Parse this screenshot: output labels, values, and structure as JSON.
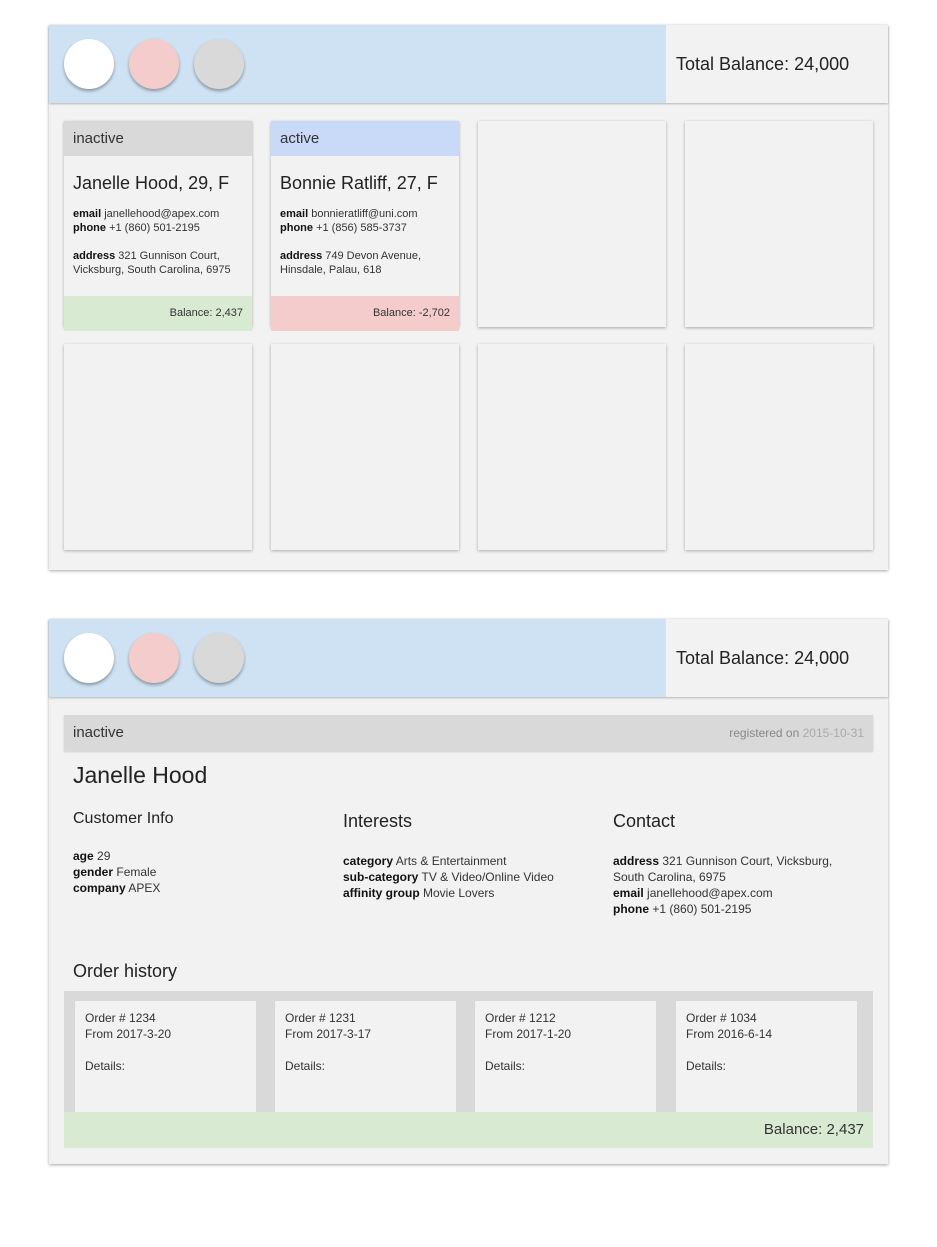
{
  "colors": {
    "header_accent": "#cfe2f3",
    "inactive": "#d9d9d9",
    "active": "#c9daf8",
    "positive": "#d9ead3",
    "negative": "#f4cccc",
    "circle_white": "#ffffff",
    "circle_pink": "#f4cccc",
    "circle_grey": "#d9d9d9"
  },
  "grid_view": {
    "total_balance": "Total Balance: 24,000",
    "cards": [
      {
        "status": "inactive",
        "name": "Janelle Hood, 29, F",
        "email_label": "email",
        "email": "janellehood@apex.com",
        "phone_label": "phone",
        "phone": "+1 (860) 501-2195",
        "address_label": "address",
        "address": "321 Gunnison Court, Vicksburg, South Carolina, 6975",
        "balance": "Balance: 2,437"
      },
      {
        "status": "active",
        "name": "Bonnie Ratliff, 27, F",
        "email_label": "email",
        "email": "bonnieratliff@uni.com",
        "phone_label": "phone",
        "phone": "+1 (856) 585-3737",
        "address_label": "address",
        "address": "749 Devon Avenue, Hinsdale, Palau, 618",
        "balance": "Balance: -2,702"
      }
    ]
  },
  "detail_view": {
    "total_balance": "Total Balance: 24,000",
    "status": "inactive",
    "registered_label": "registered on",
    "registered_date": "2015-10-31",
    "name": "Janelle Hood",
    "customer_info": {
      "title": "Customer Info",
      "age_label": "age",
      "age": "29",
      "gender_label": "gender",
      "gender": "Female",
      "company_label": "company",
      "company": "APEX"
    },
    "interests": {
      "title": "Interests",
      "category_label": "category",
      "category": "Arts & Entertainment",
      "subcategory_label": "sub-category",
      "subcategory": "TV & Video/Online Video",
      "affinity_label": "affinity group",
      "affinity": "Movie Lovers"
    },
    "contact": {
      "title": "Contact",
      "address_label": "address",
      "address": "321 Gunnison Court, Vicksburg, South Carolina, 6975",
      "email_label": "email",
      "email": "janellehood@apex.com",
      "phone_label": "phone",
      "phone": "+1 (860) 501-2195"
    },
    "order_history_title": "Order history",
    "orders": [
      {
        "order": "Order # 1234",
        "from": "From 2017-3-20",
        "details": "Details:"
      },
      {
        "order": "Order # 1231",
        "from": "From 2017-3-17",
        "details": "Details:"
      },
      {
        "order": "Order # 1212",
        "from": "From 2017-1-20",
        "details": "Details:"
      },
      {
        "order": "Order # 1034",
        "from": "From 2016-6-14",
        "details": "Details:"
      }
    ],
    "balance": "Balance: 2,437"
  }
}
